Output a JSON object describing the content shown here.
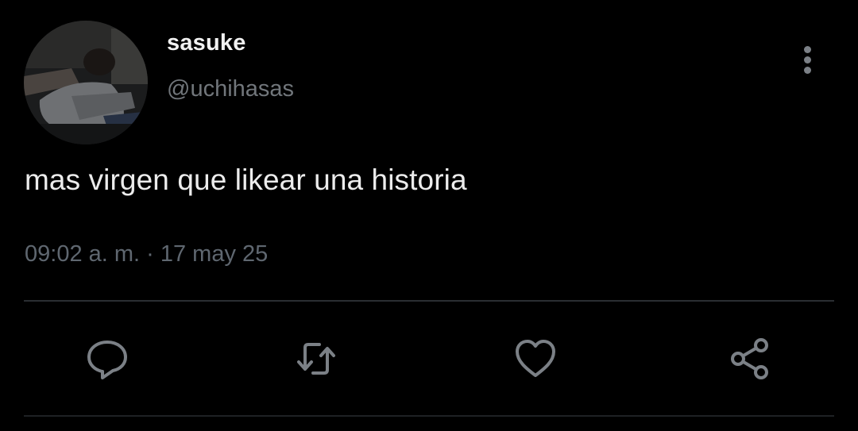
{
  "tweet": {
    "author": {
      "display_name": "sasuke",
      "handle": "@uchihasas"
    },
    "text": "mas virgen que likear una historia",
    "timestamp": "09:02 a. m. · 17 may 25"
  },
  "actions": {
    "reply_icon": "speech-bubble-icon",
    "retweet_icon": "retweet-icon",
    "like_icon": "heart-icon",
    "share_icon": "share-icon"
  },
  "colors": {
    "background": "#000000",
    "primary_text": "#ececec",
    "secondary_text": "#71767b",
    "icon": "#7b8086",
    "divider": "#2a2e32"
  }
}
